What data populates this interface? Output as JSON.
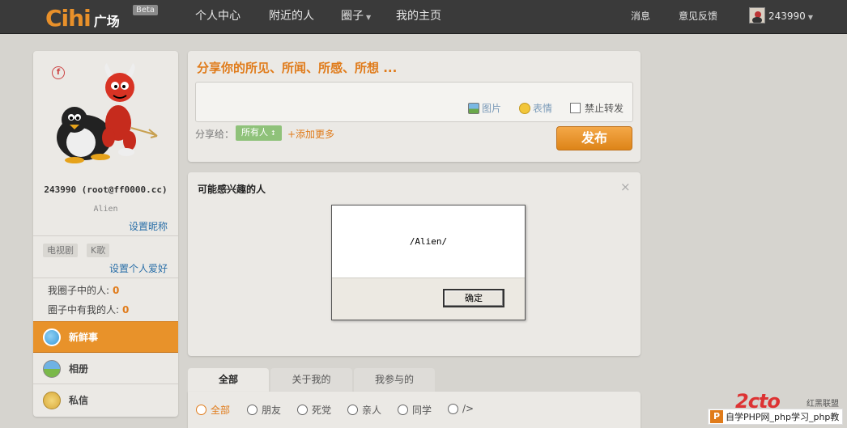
{
  "brand": {
    "logo": "Cihi",
    "logo_suffix": "广场",
    "beta": "Beta"
  },
  "nav": {
    "items": [
      "个人中心",
      "附近的人",
      "圈子",
      "我的主页"
    ],
    "right": {
      "messages": "消息",
      "feedback": "意见反馈",
      "username": "243990"
    }
  },
  "profile": {
    "name": "243990 (root@ff0000.cc)",
    "alias": "Alien",
    "set_nickname": "设置昵称",
    "tags": [
      "电视剧",
      "K歌"
    ],
    "set_hobby": "设置个人爱好",
    "stats": [
      {
        "label": "我圈子中的人:",
        "value": "0"
      },
      {
        "label": "圈子中有我的人:",
        "value": "0"
      }
    ],
    "menu": [
      {
        "label": "新鲜事",
        "icon": "chat-bubble-icon",
        "active": true
      },
      {
        "label": "相册",
        "icon": "album-icon",
        "active": false
      },
      {
        "label": "私信",
        "icon": "mail-icon",
        "active": false
      }
    ]
  },
  "post": {
    "title": "分享你的所见、所闻、所感、所想 ...",
    "tools": {
      "image": "图片",
      "emoji": "表情",
      "no_forward": "禁止转发"
    },
    "share_label": "分享给：",
    "share_all": "所有人",
    "add_more": "+添加更多",
    "publish": "发布"
  },
  "recommend": {
    "title": "可能感兴趣的人",
    "close": "×"
  },
  "tabs": [
    "全部",
    "关于我的",
    "我参与的"
  ],
  "filters": [
    "全部",
    "朋友",
    "死党",
    "亲人",
    "同学",
    "/>"
  ],
  "dialog": {
    "message": "/Alien/",
    "ok": "确定"
  },
  "watermark": {
    "text": "自学PHP网_php学习_php教",
    "logo": "2cto",
    "logo2": "红黑联盟"
  },
  "colors": {
    "accent": "#e07b1a",
    "topbar": "#3a3a3a",
    "link": "#2a6fa8"
  }
}
